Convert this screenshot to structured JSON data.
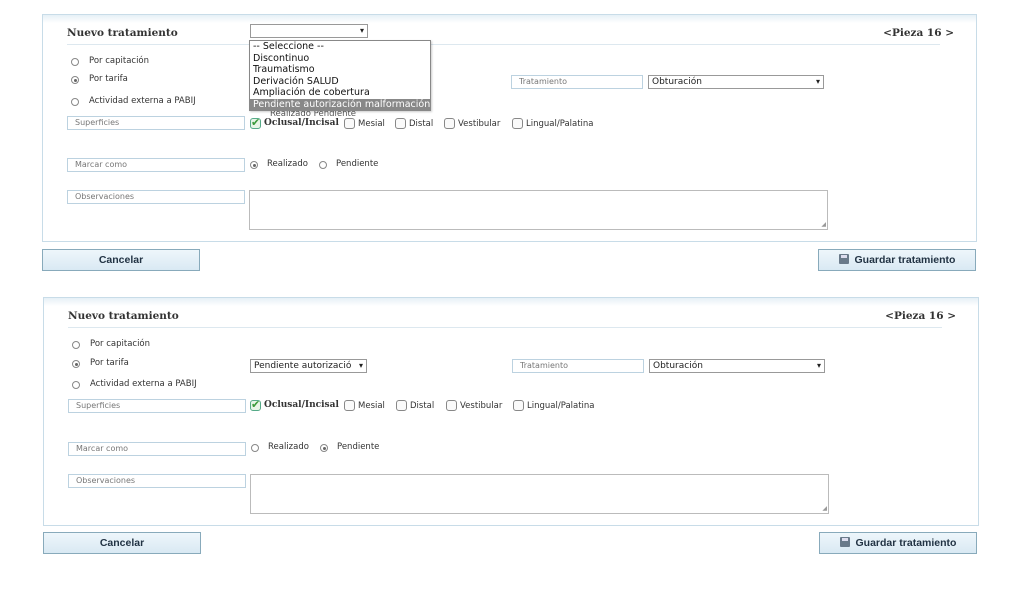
{
  "panel1": {
    "title": "Nuevo tratamiento",
    "pieza": "<Pieza 16 >",
    "radios": [
      {
        "label": "Por capitación",
        "checked": false
      },
      {
        "label": "Por tarifa",
        "checked": true
      },
      {
        "label": "Actividad externa a PABIJ",
        "checked": false
      }
    ],
    "select_value": "",
    "dropdown_options": [
      "-- Seleccione --",
      "Discontinuo",
      "Traumatismo",
      "Derivación SALUD",
      "Ampliación de cobertura",
      "Pendiente autorización malformación"
    ],
    "dropdown_selected_index": 5,
    "tratamiento_label": "Tratamiento",
    "tratamiento_value": "Obturación",
    "superficies_label": "Superficies",
    "surfaces": [
      {
        "label": "Oclusal/Incisal",
        "checked": true
      },
      {
        "label": "Mesial",
        "checked": false
      },
      {
        "label": "Distal",
        "checked": false
      },
      {
        "label": "Vestibular",
        "checked": false
      },
      {
        "label": "Lingual/Palatina",
        "checked": false
      }
    ],
    "ghost_text": "Realizado   Pendiente",
    "marcar_label": "Marcar como",
    "marcar_options": [
      {
        "label": "Realizado",
        "checked": true
      },
      {
        "label": "Pendiente",
        "checked": false
      }
    ],
    "observaciones_label": "Observaciones",
    "cancel": "Cancelar",
    "save": "Guardar tratamiento"
  },
  "panel2": {
    "title": "Nuevo tratamiento",
    "pieza": "<Pieza 16 >",
    "radios": [
      {
        "label": "Por capitación",
        "checked": false
      },
      {
        "label": "Por tarifa",
        "checked": true
      },
      {
        "label": "Actividad externa a PABIJ",
        "checked": false
      }
    ],
    "select_value": "Pendiente autorizació",
    "tratamiento_label": "Tratamiento",
    "tratamiento_value": "Obturación",
    "superficies_label": "Superficies",
    "surfaces": [
      {
        "label": "Oclusal/Incisal",
        "checked": true
      },
      {
        "label": "Mesial",
        "checked": false
      },
      {
        "label": "Distal",
        "checked": false
      },
      {
        "label": "Vestibular",
        "checked": false
      },
      {
        "label": "Lingual/Palatina",
        "checked": false
      }
    ],
    "marcar_label": "Marcar como",
    "marcar_options": [
      {
        "label": "Realizado",
        "checked": false
      },
      {
        "label": "Pendiente",
        "checked": true
      }
    ],
    "observaciones_label": "Observaciones",
    "cancel": "Cancelar",
    "save": "Guardar tratamiento"
  }
}
